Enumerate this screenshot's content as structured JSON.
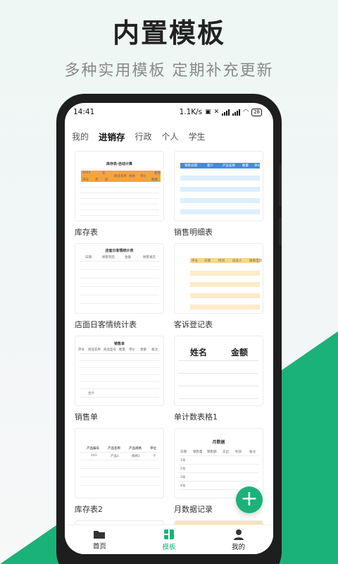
{
  "headline": "内置模板",
  "subline": "多种实用模板 定期补充更新",
  "status": {
    "time": "14:41",
    "speed": "1.1K/s",
    "battery": "28"
  },
  "tabs": [
    {
      "label": "我的"
    },
    {
      "label": "进销存"
    },
    {
      "label": "行政"
    },
    {
      "label": "个人"
    },
    {
      "label": "学生"
    }
  ],
  "templates": [
    {
      "label": "库存表",
      "thumb_title": "库存表-自动计算",
      "cells": [
        "2022",
        "年",
        "商品名称",
        "规格",
        "单价",
        "使用",
        "序号",
        "月",
        "日",
        "数量"
      ]
    },
    {
      "label": "销售明细表",
      "cells": [
        "销售日期",
        "客户",
        "产品名称",
        "数量",
        "单价"
      ]
    },
    {
      "label": "店面日客情统计表",
      "thumb_title": "店面日客情统计表",
      "cells": [
        "日期",
        "顾客到店",
        "金额",
        "顾客离店"
      ]
    },
    {
      "label": "客诉登记表",
      "cells": [
        "序号",
        "日期",
        "时间",
        "投诉人",
        "联系电话"
      ]
    },
    {
      "label": "销售单",
      "thumb_title": "销售单",
      "cells": [
        "序号",
        "商品名称",
        "商品型号",
        "数量",
        "单价",
        "金额",
        "备注",
        "合计"
      ]
    },
    {
      "label": "单计数表格1",
      "cells": [
        "姓名",
        "金额"
      ]
    },
    {
      "label": "库存表2",
      "cells": [
        "产品编号",
        "产品名称",
        "产品规格",
        "单位",
        "101",
        "产品1",
        "规格1",
        "个"
      ]
    },
    {
      "label": "月数据记录",
      "thumb_title": "月数据",
      "cells": [
        "日期",
        "销售量",
        "销售额",
        "支出",
        "利润",
        "备注",
        "1号",
        "2号",
        "3号",
        "4号"
      ]
    }
  ],
  "fab": {
    "icon": "plus-icon",
    "glyph": "+"
  },
  "bottom_nav": [
    {
      "label": "首页",
      "icon": "folder-icon"
    },
    {
      "label": "模板",
      "icon": "template-icon"
    },
    {
      "label": "我的",
      "icon": "person-icon"
    }
  ],
  "colors": {
    "accent": "#1bb27a",
    "orange": "#f2a63a",
    "blue": "#3b8de3",
    "peach": "#fdebc8"
  }
}
